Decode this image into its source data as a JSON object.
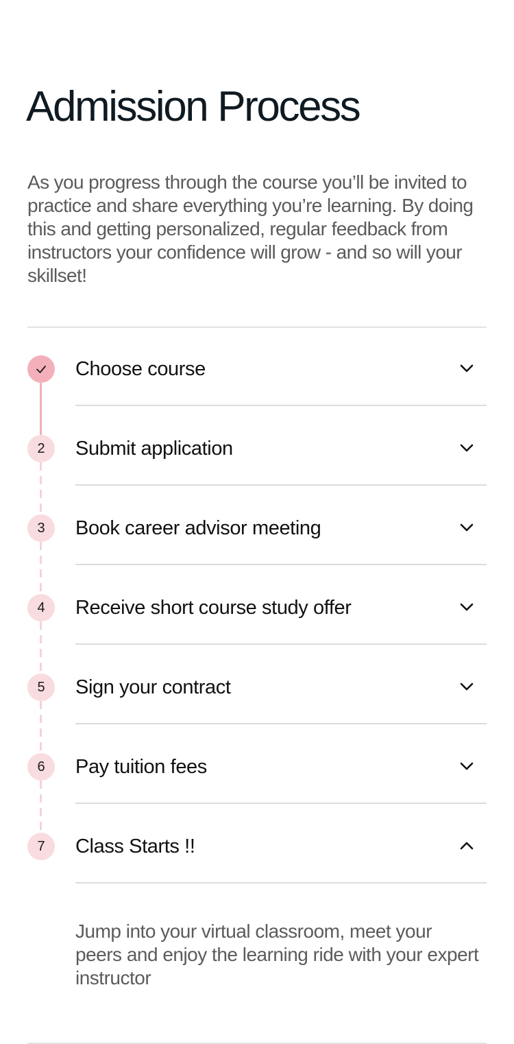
{
  "header": {
    "title": "Admission Process",
    "intro": "As you progress through the course you’ll be invited to practice and share everything you’re learning. By doing this and getting personalized, regular feedback from instructors your confidence will grow - and so will your skillset!"
  },
  "steps": [
    {
      "number": "",
      "label": "Choose course",
      "status": "completed",
      "icon": "check-icon",
      "chevron": "chevron-down-icon"
    },
    {
      "number": "2",
      "label": "Submit application",
      "status": "pending",
      "chevron": "chevron-down-icon"
    },
    {
      "number": "3",
      "label": "Book career advisor meeting",
      "status": "pending",
      "chevron": "chevron-down-icon"
    },
    {
      "number": "4",
      "label": "Receive short course study offer",
      "status": "pending",
      "chevron": "chevron-down-icon"
    },
    {
      "number": "5",
      "label": "Sign your contract",
      "status": "pending",
      "chevron": "chevron-down-icon"
    },
    {
      "number": "6",
      "label": "Pay tuition fees",
      "status": "pending",
      "chevron": "chevron-down-icon"
    },
    {
      "number": "7",
      "label": "Class Starts !!",
      "status": "pending",
      "expanded": true,
      "chevron": "chevron-up-icon"
    }
  ],
  "expanded_step": {
    "description": "Jump into your virtual classroom, meet your peers and enjoy the learning ride with your expert instructor"
  },
  "colors": {
    "completed_circle": "#f3b0bb",
    "pending_circle": "#f9dcdf",
    "connector_completed": "#f3b0bb",
    "connector_pending": "#f7d2d7",
    "title": "#0f1a22",
    "body_text": "#5b5b5b",
    "divider": "#dcdcdc"
  }
}
